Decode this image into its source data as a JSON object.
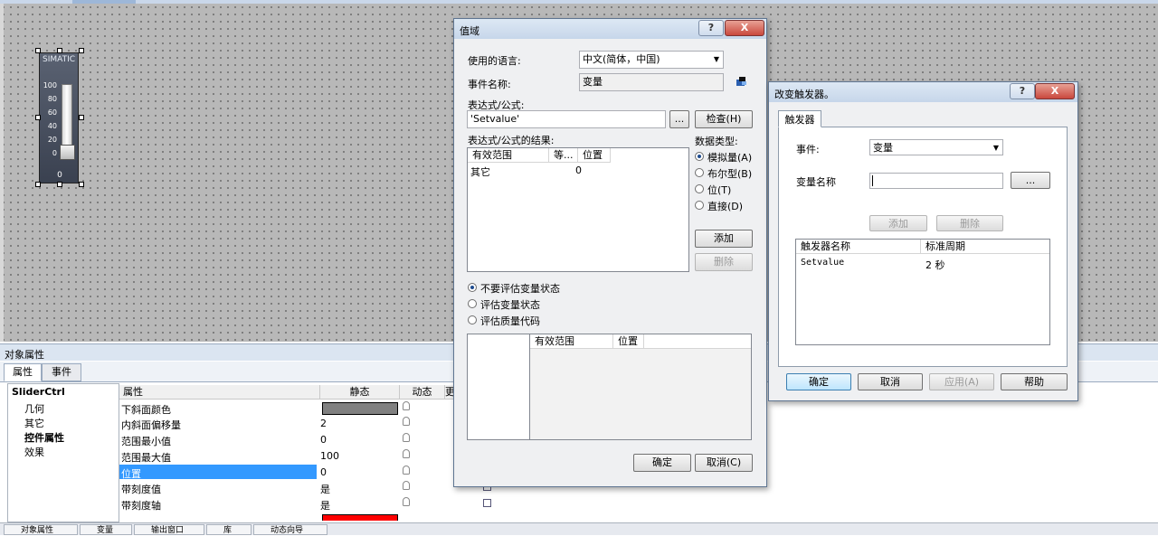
{
  "canvas": {
    "slider": {
      "title": "SIMATIC",
      "scale": [
        "100",
        "80",
        "60",
        "40",
        "20",
        "0"
      ],
      "value": "0"
    }
  },
  "properties_panel": {
    "title": "对象属性",
    "tabs": [
      "属性",
      "事件"
    ],
    "tree": {
      "root": "SliderCtrl",
      "nodes": [
        "几何",
        "其它",
        "控件属性",
        "效果"
      ]
    },
    "grid_headers": [
      "属性",
      "静态",
      "动态",
      "更"
    ],
    "rows": [
      {
        "name": "下斜面颜色",
        "value": "",
        "swatch": "#808080"
      },
      {
        "name": "内斜面偏移量",
        "value": "2"
      },
      {
        "name": "范围最小值",
        "value": "0"
      },
      {
        "name": "范围最大值",
        "value": "100"
      },
      {
        "name": "位置",
        "value": "0",
        "selected": true
      },
      {
        "name": "带刻度值",
        "value": "是"
      },
      {
        "name": "带刻度轴",
        "value": "是"
      },
      {
        "name": "",
        "value": "",
        "swatch": "#ff0000"
      }
    ]
  },
  "taskbar": {
    "items": [
      "对象属性",
      "变量",
      "输出窗口",
      "库",
      "动态向导"
    ]
  },
  "value_dialog": {
    "title": "值域",
    "help": "?",
    "close": "X",
    "language_label": "使用的语言:",
    "language_value": "中文(简体，中国)",
    "event_name_label": "事件名称:",
    "event_name_value": "变量",
    "expression_label": "表达式/公式:",
    "expression_value": "'Setvalue'",
    "browse_label": "...",
    "check_button": "检查(H)",
    "result_label": "表达式/公式的结果:",
    "result_columns": [
      "有效范围",
      "等...",
      "位置"
    ],
    "result_rows": [
      {
        "range": "其它",
        "value": "0"
      }
    ],
    "data_type_label": "数据类型:",
    "data_types": [
      "模拟量(A)",
      "布尔型(B)",
      "位(T)",
      "直接(D)"
    ],
    "add_button": "添加",
    "delete_button": "删除",
    "eval_options": [
      "不要评估变量状态",
      "评估变量状态",
      "评估质量代码"
    ],
    "bottom_columns": [
      "有效范围",
      "位置"
    ],
    "ok_button": "确定",
    "cancel_button": "取消(C)"
  },
  "trigger_dialog": {
    "title": "改变触发器。",
    "help": "?",
    "close": "X",
    "tab": "触发器",
    "event_label": "事件:",
    "event_value": "变量",
    "tag_name_label": "变量名称",
    "tag_name_value": "",
    "browse_label": "...",
    "add_button": "添加",
    "delete_button": "删除",
    "columns": [
      "触发器名称",
      "标准周期"
    ],
    "rows": [
      {
        "name": "Setvalue",
        "cycle": "2 秒"
      }
    ],
    "ok_button": "确定",
    "cancel_button": "取消",
    "apply_button": "应用(A)",
    "help_button": "帮助"
  },
  "colors": {
    "selection": "#3399ff",
    "close_button": "#c9483d",
    "title_bar": "#c6d6ea"
  }
}
